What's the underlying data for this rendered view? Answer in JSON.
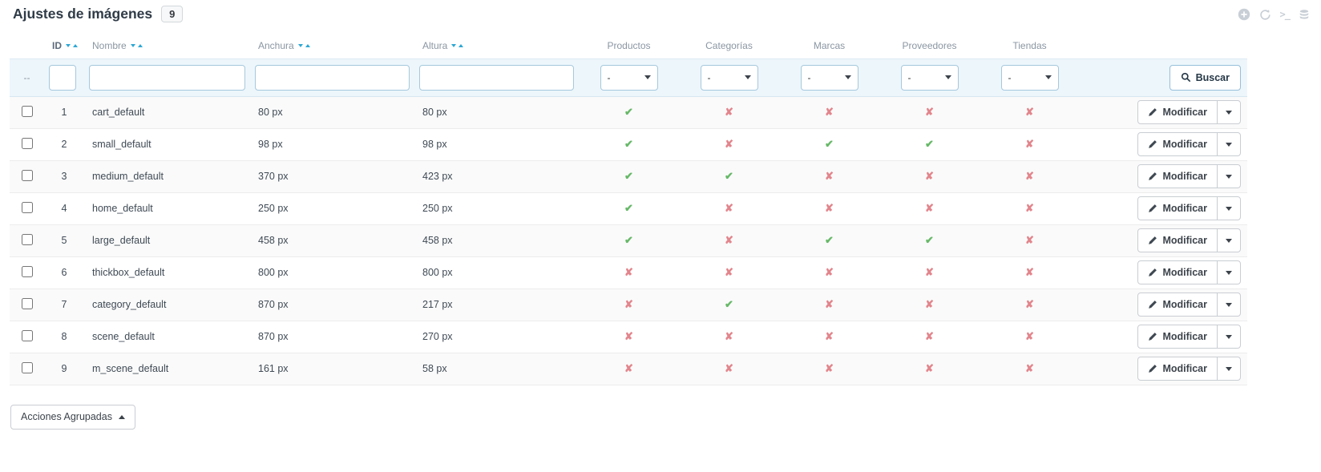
{
  "header": {
    "title": "Ajustes de imágenes",
    "count": "9",
    "toolbar": {
      "icons": [
        "add-icon",
        "refresh-icon",
        "terminal-icon",
        "database-icon"
      ],
      "terminal_label": ">_"
    }
  },
  "table": {
    "headers": {
      "id": "ID",
      "name": "Nombre",
      "width": "Anchura",
      "height": "Altura",
      "products": "Productos",
      "categories": "Categorías",
      "brands": "Marcas",
      "suppliers": "Proveedores",
      "stores": "Tiendas"
    },
    "filter": {
      "checkbox_placeholder": "--",
      "select_value": "-",
      "search_label": "Buscar"
    },
    "row_action_label": "Modificar",
    "rows": [
      {
        "id": "1",
        "name": "cart_default",
        "width": "80 px",
        "height": "80 px",
        "products": true,
        "categories": false,
        "brands": false,
        "suppliers": false,
        "stores": false
      },
      {
        "id": "2",
        "name": "small_default",
        "width": "98 px",
        "height": "98 px",
        "products": true,
        "categories": false,
        "brands": true,
        "suppliers": true,
        "stores": false
      },
      {
        "id": "3",
        "name": "medium_default",
        "width": "370 px",
        "height": "423 px",
        "products": true,
        "categories": true,
        "brands": false,
        "suppliers": false,
        "stores": false
      },
      {
        "id": "4",
        "name": "home_default",
        "width": "250 px",
        "height": "250 px",
        "products": true,
        "categories": false,
        "brands": false,
        "suppliers": false,
        "stores": false
      },
      {
        "id": "5",
        "name": "large_default",
        "width": "458 px",
        "height": "458 px",
        "products": true,
        "categories": false,
        "brands": true,
        "suppliers": true,
        "stores": false
      },
      {
        "id": "6",
        "name": "thickbox_default",
        "width": "800 px",
        "height": "800 px",
        "products": false,
        "categories": false,
        "brands": false,
        "suppliers": false,
        "stores": false
      },
      {
        "id": "7",
        "name": "category_default",
        "width": "870 px",
        "height": "217 px",
        "products": false,
        "categories": true,
        "brands": false,
        "suppliers": false,
        "stores": false
      },
      {
        "id": "8",
        "name": "scene_default",
        "width": "870 px",
        "height": "270 px",
        "products": false,
        "categories": false,
        "brands": false,
        "suppliers": false,
        "stores": false
      },
      {
        "id": "9",
        "name": "m_scene_default",
        "width": "161 px",
        "height": "58 px",
        "products": false,
        "categories": false,
        "brands": false,
        "suppliers": false,
        "stores": false
      }
    ]
  },
  "icons": {
    "check_glyph": "✔",
    "cross_glyph": "✘"
  },
  "bulk_actions": {
    "label": "Acciones Agrupadas"
  },
  "colors": {
    "check": "#67b868",
    "cross": "#e2858c",
    "sort_caret": "#2da7d4",
    "filter_bg": "#edf6fb"
  }
}
